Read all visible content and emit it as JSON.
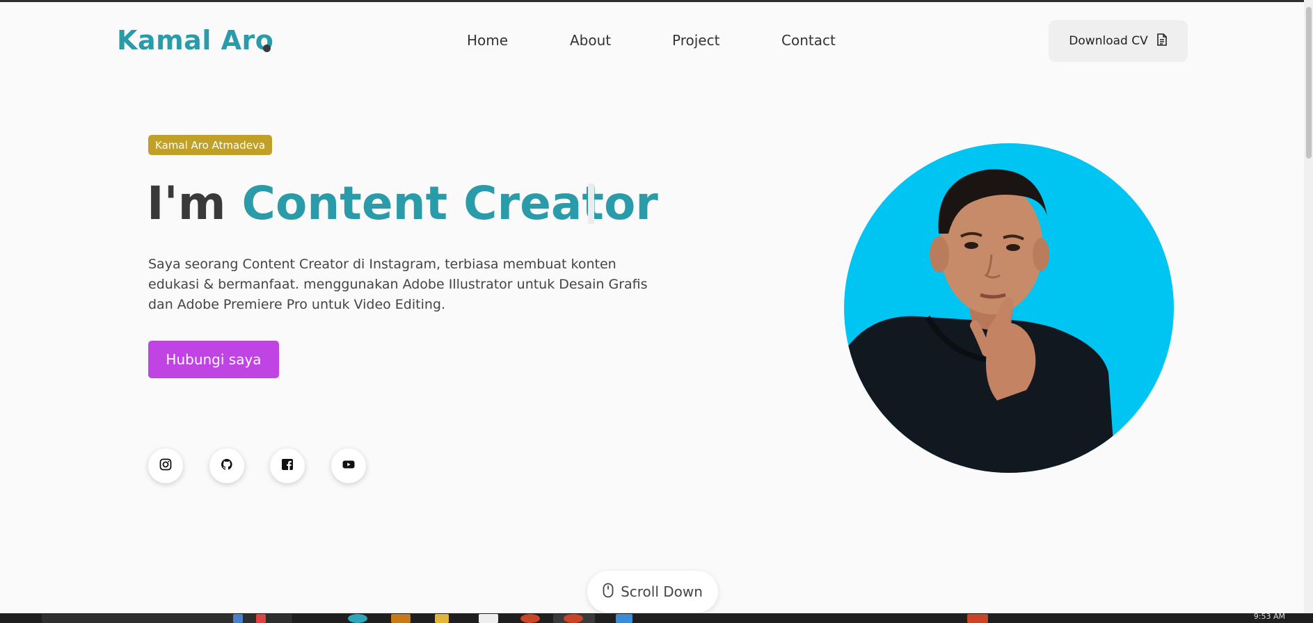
{
  "header": {
    "logo": "Kamal Aro",
    "nav": [
      "Home",
      "About",
      "Project",
      "Contact"
    ],
    "cv_button": "Download CV"
  },
  "hero": {
    "badge": "Kamal Aro Atmadeva",
    "headline_prefix": "I'm",
    "headline_role": "Content Creator",
    "description": "Saya seorang Content Creator di Instagram, terbiasa membuat konten edukasi & bermanfaat. menggunakan Adobe Illustrator untuk Desain Grafis dan Adobe Premiere Pro untuk Video Editing.",
    "contact_button": "Hubungi saya"
  },
  "social_icons": [
    "instagram-icon",
    "github-icon",
    "facebook-icon",
    "youtube-icon"
  ],
  "scroll": {
    "label": "Scroll Down"
  },
  "taskbar": {
    "clock": "9:53 AM"
  },
  "colors": {
    "brand": "#2a9ba8",
    "badge": "#c1a028",
    "contact_button": "#c043e3",
    "photo_background": "#00c4f2"
  }
}
